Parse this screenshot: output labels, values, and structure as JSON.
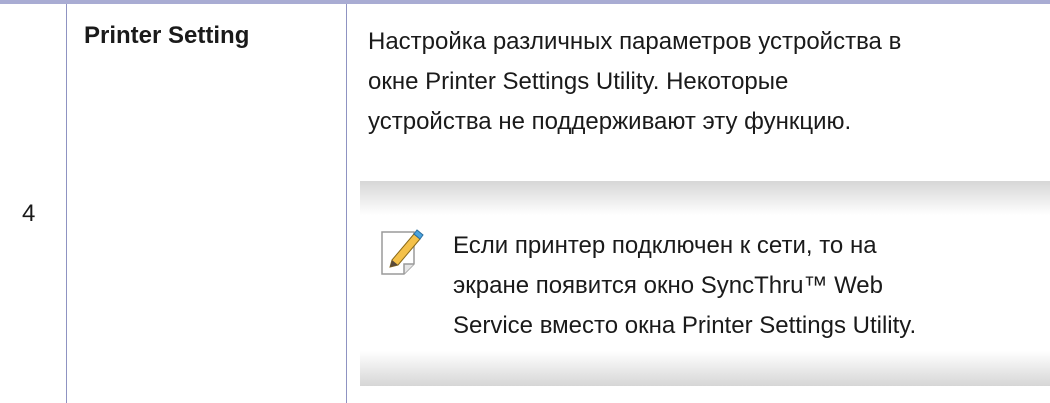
{
  "row": {
    "number": "4",
    "feature": "Printer Setting",
    "description": [
      "Настройка различных параметров устройства в",
      "окне Printer Settings Utility. Некоторые",
      "устройства не поддерживают эту функцию."
    ],
    "note": {
      "icon": "note-pencil-icon",
      "lines": [
        "Если принтер подключен к сети, то на",
        "экране появится окно SyncThru™ Web",
        "Service вместо окна Printer Settings Utility."
      ]
    }
  }
}
